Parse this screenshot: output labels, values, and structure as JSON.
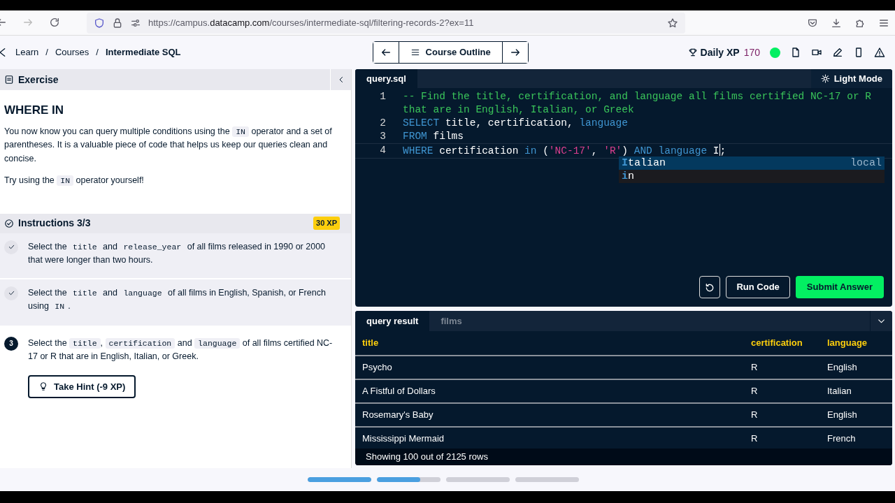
{
  "browser": {
    "url": {
      "prefix": "https://campus.",
      "domain": "datacamp.com",
      "path": "/courses/intermediate-sql/filtering-records-2?ex=11"
    }
  },
  "header": {
    "breadcrumb": [
      {
        "label": "Learn",
        "current": false
      },
      {
        "label": "Courses",
        "current": false
      },
      {
        "label": "Intermediate SQL",
        "current": true
      }
    ],
    "separators": [
      "/",
      "/"
    ],
    "outline_button": "Course Outline",
    "daily_xp": {
      "label": "Daily XP",
      "value": "170"
    }
  },
  "exercise": {
    "panel_title": "Exercise",
    "title": "WHERE IN",
    "paragraphs": [
      [
        {
          "text": "You now know you can query multiple conditions using the ",
          "kind": "text"
        },
        {
          "text": "IN",
          "kind": "code"
        },
        {
          "text": " operator and a set of parentheses. It is a valuable piece of code that helps us keep our queries clean and concise.",
          "kind": "text"
        }
      ],
      [
        {
          "text": "Try using the ",
          "kind": "text"
        },
        {
          "text": "IN",
          "kind": "code"
        },
        {
          "text": " operator yourself!",
          "kind": "text"
        }
      ]
    ]
  },
  "instructions": {
    "title": "Instructions 3/3",
    "xp": "30 XP",
    "steps": [
      {
        "done": true,
        "parts": [
          {
            "text": "Select the ",
            "kind": "text"
          },
          {
            "text": "title",
            "kind": "code"
          },
          {
            "text": " and ",
            "kind": "text"
          },
          {
            "text": "release_year",
            "kind": "code"
          },
          {
            "text": " of all films released in 1990 or 2000 that were longer than two hours.",
            "kind": "text"
          }
        ]
      },
      {
        "done": true,
        "parts": [
          {
            "text": "Select the ",
            "kind": "text"
          },
          {
            "text": "title",
            "kind": "code"
          },
          {
            "text": " and ",
            "kind": "text"
          },
          {
            "text": "language",
            "kind": "code"
          },
          {
            "text": " of all films in English, Spanish, or French using ",
            "kind": "text"
          },
          {
            "text": "IN",
            "kind": "code"
          },
          {
            "text": ".",
            "kind": "text"
          }
        ]
      },
      {
        "done": false,
        "number": "3",
        "parts": [
          {
            "text": "Select the ",
            "kind": "text"
          },
          {
            "text": "title",
            "kind": "code"
          },
          {
            "text": ", ",
            "kind": "text"
          },
          {
            "text": "certification",
            "kind": "code"
          },
          {
            "text": " and ",
            "kind": "text"
          },
          {
            "text": "language",
            "kind": "code"
          },
          {
            "text": " of all films certified NC-17 or R that are in English, Italian, or Greek.",
            "kind": "text"
          }
        ]
      }
    ],
    "hint_button": "Take Hint (-9 XP)"
  },
  "editor": {
    "tab": "query.sql",
    "mode_button": "Light Mode",
    "lines": [
      {
        "number": "1",
        "active": false,
        "tokens": [
          {
            "text": "-- Find the title, certification, and language all films certified NC-17 or R that are in English, Italian, or Greek",
            "kind": "comment"
          }
        ]
      },
      {
        "number": "2",
        "active": false,
        "tokens": [
          {
            "text": "SELECT",
            "kind": "keyword"
          },
          {
            "text": " title, certification, ",
            "kind": "plain"
          },
          {
            "text": "language",
            "kind": "keyword"
          }
        ]
      },
      {
        "number": "3",
        "active": false,
        "tokens": [
          {
            "text": "FROM",
            "kind": "keyword"
          },
          {
            "text": " films",
            "kind": "plain"
          }
        ]
      },
      {
        "number": "4",
        "active": true,
        "tokens": [
          {
            "text": "WHERE",
            "kind": "keyword"
          },
          {
            "text": " certification ",
            "kind": "plain"
          },
          {
            "text": "in",
            "kind": "keyword"
          },
          {
            "text": " (",
            "kind": "plain"
          },
          {
            "text": "'NC-17'",
            "kind": "string"
          },
          {
            "text": ", ",
            "kind": "plain"
          },
          {
            "text": "'R'",
            "kind": "string"
          },
          {
            "text": ") ",
            "kind": "plain"
          },
          {
            "text": "AND",
            "kind": "keyword"
          },
          {
            "text": " language",
            "kind": "keyword"
          },
          {
            "text": " I",
            "kind": "plain"
          },
          {
            "text": ";",
            "kind": "plain",
            "cursor": true
          }
        ]
      }
    ],
    "suggestions": [
      {
        "match": "I",
        "rest": "talian",
        "detail": "local",
        "selected": true
      },
      {
        "match": "i",
        "rest": "n",
        "selected": false
      }
    ],
    "run_button": "Run Code",
    "submit_button": "Submit Answer"
  },
  "results": {
    "tabs": [
      {
        "label": "query result",
        "selected": true
      },
      {
        "label": "films",
        "selected": false
      }
    ],
    "columns": [
      "title",
      "certification",
      "language"
    ],
    "rows": [
      [
        "Psycho",
        "R",
        "English"
      ],
      [
        "A Fistful of Dollars",
        "R",
        "Italian"
      ],
      [
        "Rosemary's Baby",
        "R",
        "English"
      ],
      [
        "Mississippi Mermaid",
        "R",
        "French"
      ]
    ],
    "footer": "Showing 100 out of 2125 rows"
  },
  "progress": [
    {
      "level": 1
    },
    {
      "level": 0.68
    },
    {
      "level": 0
    },
    {
      "level": 0
    }
  ]
}
